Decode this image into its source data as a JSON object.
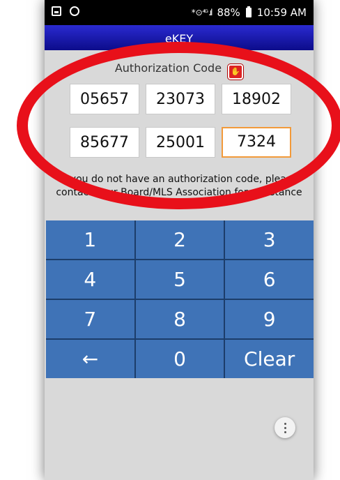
{
  "status_bar": {
    "icons_left": [
      "gallery-icon",
      "circle-icon"
    ],
    "signal_text": "* ⊙ ⁴ᴳ .ıl",
    "battery": "88%",
    "time": "10:59 AM"
  },
  "app": {
    "title": "eKEY"
  },
  "auth": {
    "label": "Authorization Code",
    "codes": [
      "05657",
      "23073",
      "18902",
      "85677",
      "25001",
      "7324"
    ]
  },
  "help": {
    "text": "If you do not have an authorization code, please contact your Board/MLS Association for assistance"
  },
  "keypad": {
    "keys": [
      "1",
      "2",
      "3",
      "4",
      "5",
      "6",
      "7",
      "8",
      "9",
      "←",
      "0",
      "Clear"
    ]
  },
  "colors": {
    "titlebar": "#0c0c8a",
    "keypad": "#3f73b7",
    "active_border": "#f29a3a",
    "annotation": "#e8101a"
  }
}
